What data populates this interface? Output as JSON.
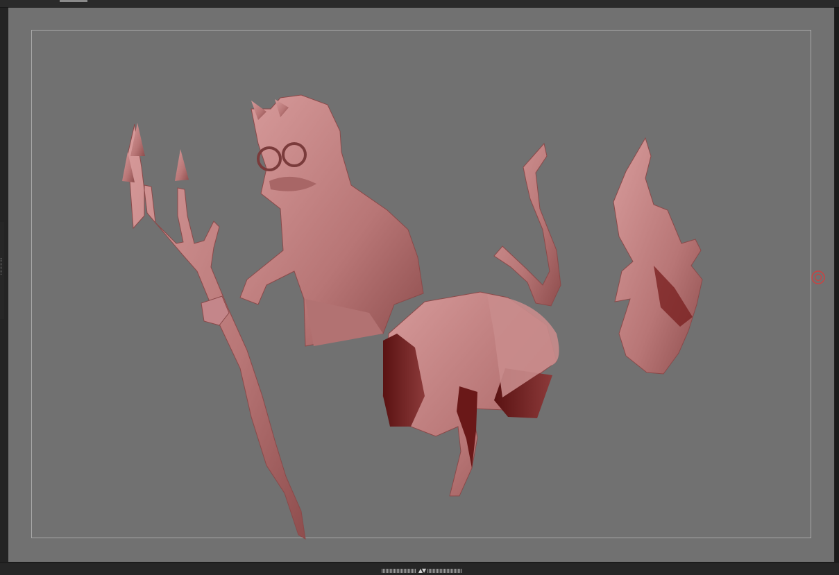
{
  "colors": {
    "viewport_background": "#717171",
    "frame_guide": "#a9a9a9",
    "clay_material": "#c98c8c",
    "clay_shadow": "#6e1a1a",
    "pivot_marker": "#d0403f",
    "chrome": "#232323"
  },
  "icons": {
    "pivot": "target-icon",
    "resize_handle": "up-down-arrows-icon"
  },
  "viewport": {
    "objects": [
      "trident",
      "devil-torso",
      "tail",
      "shorts-and-legs",
      "flame"
    ]
  }
}
